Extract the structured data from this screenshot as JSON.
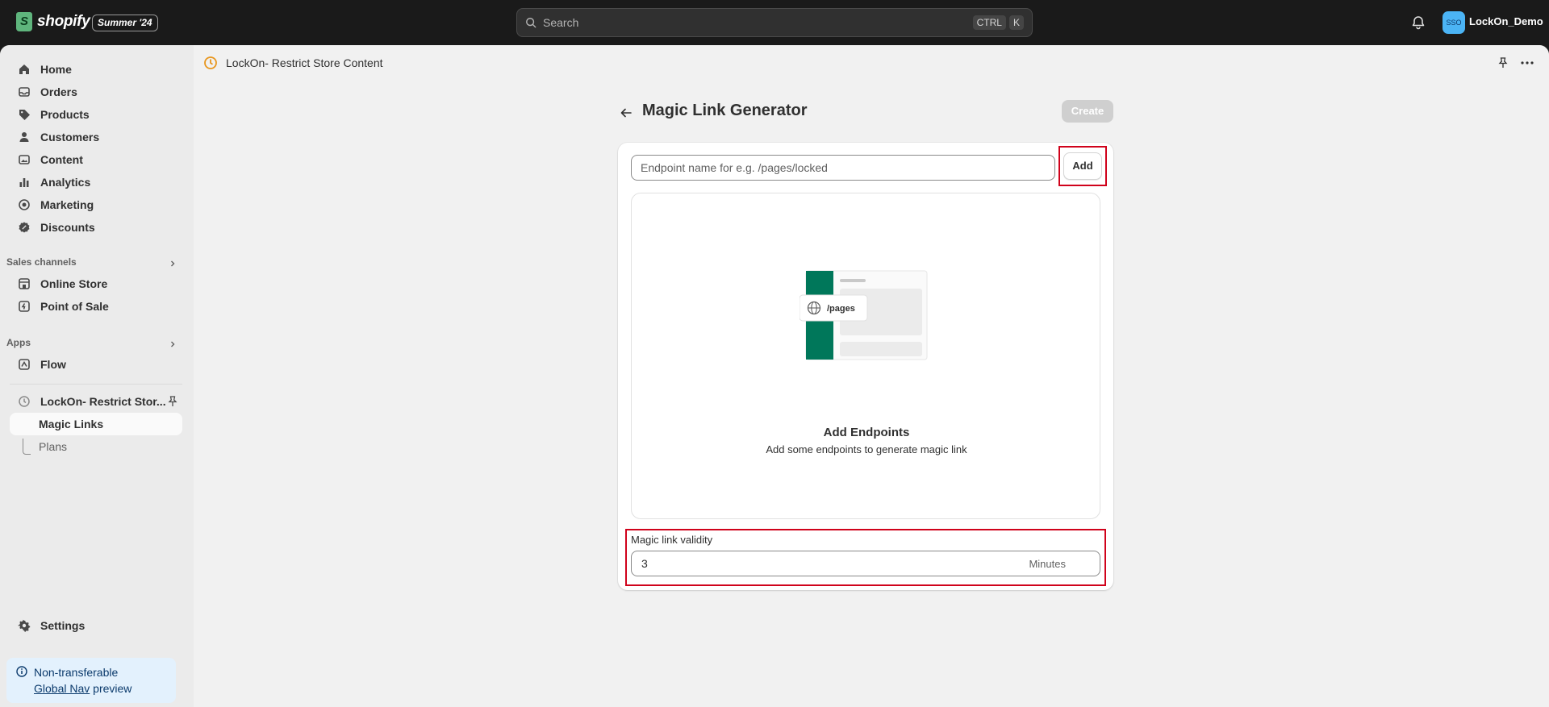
{
  "topbar": {
    "brand": "shopify",
    "edition": "Summer '24",
    "search_placeholder": "Search",
    "shortcut_ctrl": "CTRL",
    "shortcut_key": "K",
    "avatar_initials": "SSO",
    "store_name": "LockOn_Demo"
  },
  "sidebar": {
    "main_items": [
      {
        "label": "Home",
        "icon": "home-icon"
      },
      {
        "label": "Orders",
        "icon": "inbox-icon"
      },
      {
        "label": "Products",
        "icon": "tag-icon"
      },
      {
        "label": "Customers",
        "icon": "person-icon"
      },
      {
        "label": "Content",
        "icon": "image-icon"
      },
      {
        "label": "Analytics",
        "icon": "bar-chart-icon"
      },
      {
        "label": "Marketing",
        "icon": "target-icon"
      },
      {
        "label": "Discounts",
        "icon": "discount-icon"
      }
    ],
    "sales_channels_label": "Sales channels",
    "sales_channels": [
      {
        "label": "Online Store",
        "icon": "store-icon"
      },
      {
        "label": "Point of Sale",
        "icon": "pos-icon"
      }
    ],
    "apps_label": "Apps",
    "apps": [
      {
        "label": "Flow",
        "icon": "flow-icon"
      }
    ],
    "app_name": "LockOn- Restrict Stor...",
    "app_subitems": [
      {
        "label": "Magic Links",
        "active": true
      },
      {
        "label": "Plans",
        "active": false
      }
    ],
    "settings_label": "Settings",
    "preview_line1": "Non-transferable",
    "preview_link": "Global Nav",
    "preview_line2": " preview"
  },
  "content": {
    "app_title": "LockOn- Restrict Store Content",
    "page_title": "Magic Link Generator",
    "create_label": "Create",
    "endpoint_placeholder": "Endpoint name for e.g. /pages/locked",
    "endpoint_value": "",
    "add_label": "Add",
    "illustration_label": "/pages",
    "empty_title": "Add Endpoints",
    "empty_subtitle": "Add some endpoints to generate magic link",
    "validity_label": "Magic link validity",
    "validity_value": "3",
    "validity_suffix": "Minutes"
  },
  "colors": {
    "topbar": "#1a1a1a",
    "highlight": "#d0021b",
    "illustration_green": "#00775a",
    "preview_bg": "#e3f1fd"
  }
}
